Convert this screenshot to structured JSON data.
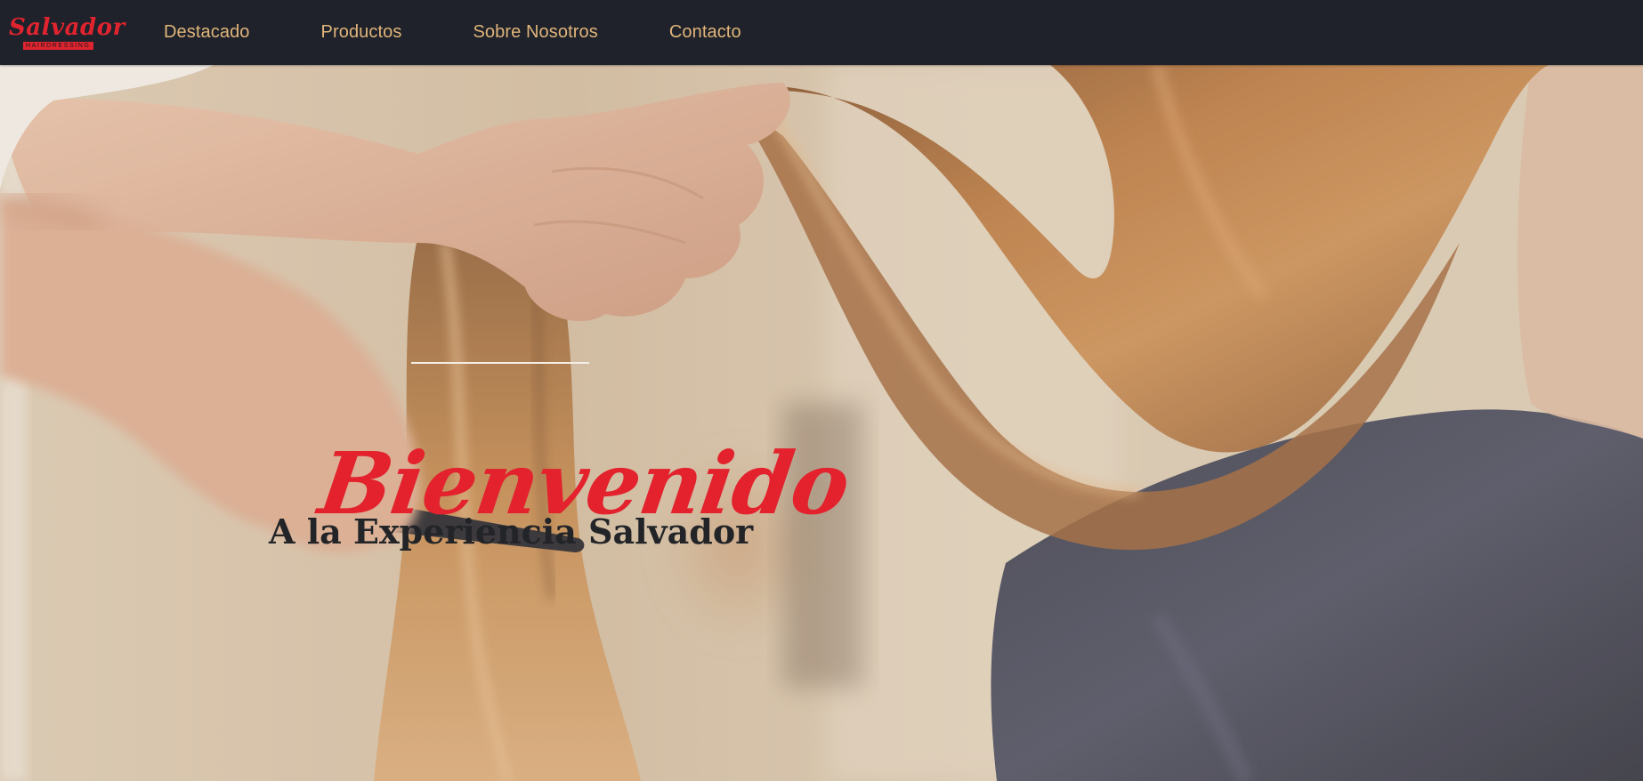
{
  "brand": {
    "name": "Salvador",
    "tagline": "HAIRDRESSING",
    "accent_color": "#e0242f"
  },
  "nav": {
    "items": [
      {
        "label": "Destacado"
      },
      {
        "label": "Productos"
      },
      {
        "label": "Sobre Nosotros"
      },
      {
        "label": "Contacto"
      }
    ],
    "link_color": "#e0b57a",
    "background": "#1f222a"
  },
  "hero": {
    "title": "Bienvenido",
    "subtitle": "A la Experiencia Salvador",
    "title_color": "#e3222d",
    "subtitle_color": "#222428",
    "background_image": "hairdresser-combing-long-hair-photo"
  }
}
